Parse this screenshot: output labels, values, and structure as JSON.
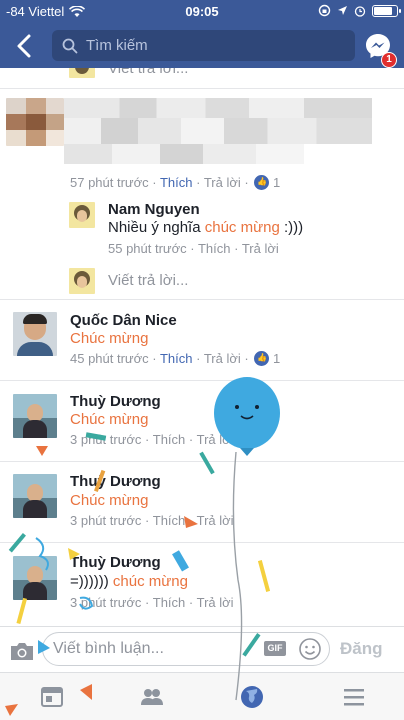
{
  "status": {
    "carrier": "-84 Viettel",
    "time": "09:05"
  },
  "nav": {
    "search_placeholder": "Tìm kiếm",
    "messenger_badge": "1"
  },
  "comments": [
    {
      "id": "c1",
      "reply_placeholder_top": "Viết trả lời...",
      "meta_time": "57 phút trước",
      "like": "Thích",
      "reply": "Trả lời",
      "reactions": "1",
      "replies": [
        {
          "name": "Nam Nguyen",
          "text_before": "Nhiều ý nghĩa ",
          "text_highlight": "chúc mừng",
          "text_after": " :)))",
          "meta_time": "55 phút trước",
          "like": "Thích",
          "reply": "Trả lời"
        }
      ],
      "reply_placeholder": "Viết trả lời..."
    },
    {
      "id": "c2",
      "name": "Quốc Dân Nice",
      "text_highlight": "Chúc mừng",
      "meta_time": "45 phút trước",
      "like": "Thích",
      "reply": "Trả lời",
      "reactions": "1"
    },
    {
      "id": "c3",
      "name": "Thuỳ Dương",
      "text_highlight": "Chúc mừng",
      "meta_time": "3 phút trước",
      "like": "Thích",
      "reply": "Trả lời"
    },
    {
      "id": "c4",
      "name": "Thuỳ Dương",
      "text_highlight": "Chúc mừng",
      "meta_time": "3 phút trước",
      "like": "Thích",
      "reply": "Trả lời"
    },
    {
      "id": "c5",
      "name": "Thuỳ Dương",
      "text_before": "=)))))) ",
      "text_highlight": "chúc mừng",
      "meta_time": "3 phút trước",
      "like": "Thích",
      "reply": "Trả lời"
    }
  ],
  "composer": {
    "placeholder": "Viết bình luận...",
    "gif_label": "GIF",
    "post_label": "Đăng"
  },
  "colors": {
    "brand": "#3b5998",
    "highlight": "#e9733f",
    "link": "#4267b2",
    "balloon": "#3fa9e0"
  },
  "icons": {
    "back": "chevron-left-icon",
    "search": "search-icon",
    "messenger": "messenger-icon",
    "camera": "camera-icon",
    "smile": "smile-icon",
    "tabs": [
      "news-feed-icon",
      "friends-icon",
      "globe-icon",
      "menu-icon"
    ]
  }
}
